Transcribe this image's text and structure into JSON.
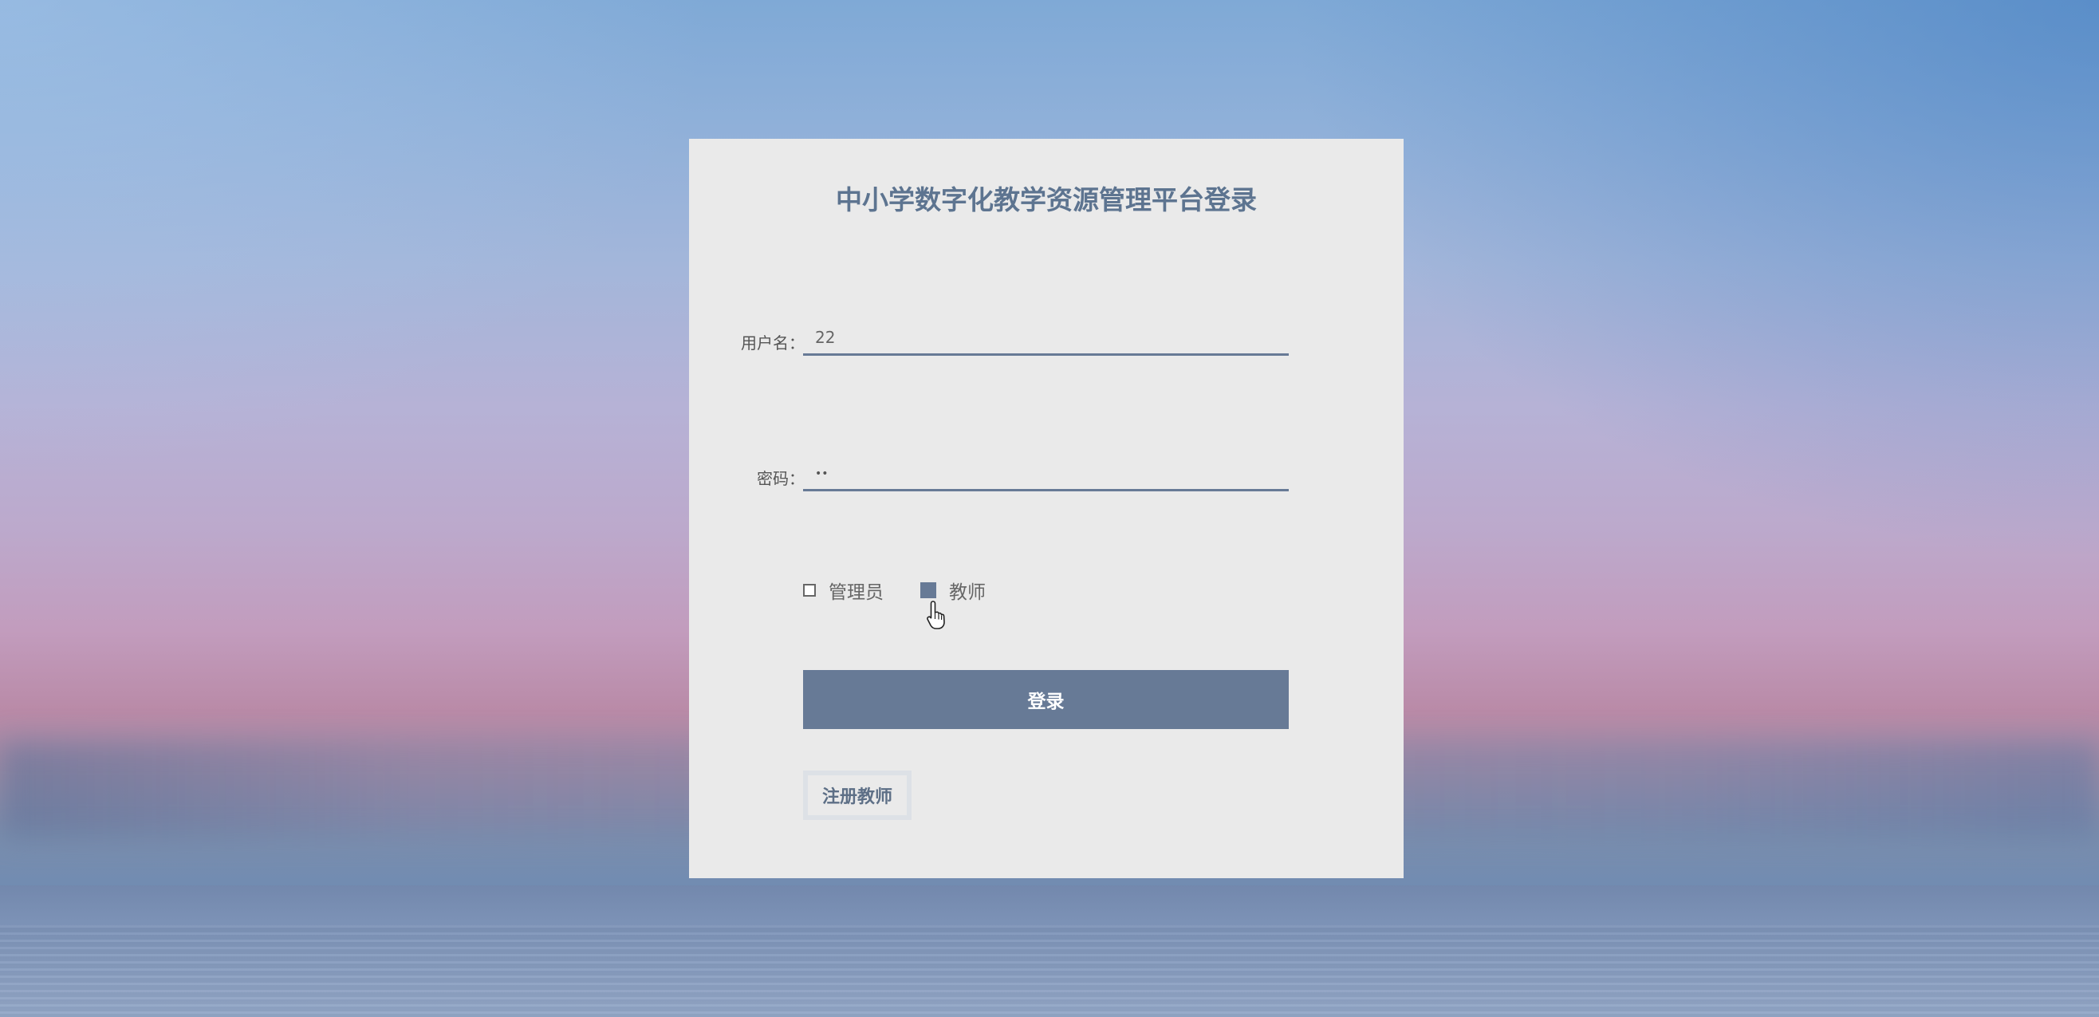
{
  "login": {
    "title": "中小学数字化教学资源管理平台登录",
    "username_label": "用户名：",
    "username_value": "22",
    "password_label": "密码：",
    "password_value": "••",
    "roles": [
      {
        "label": "管理员",
        "checked": false
      },
      {
        "label": "教师",
        "checked": true
      }
    ],
    "login_button": "登录",
    "register_button": "注册教师"
  },
  "colors": {
    "accent": "#677a96",
    "title": "#5d7490",
    "panel": "#eaeaea"
  },
  "icons": {
    "cursor": "hand-pointer-icon"
  }
}
